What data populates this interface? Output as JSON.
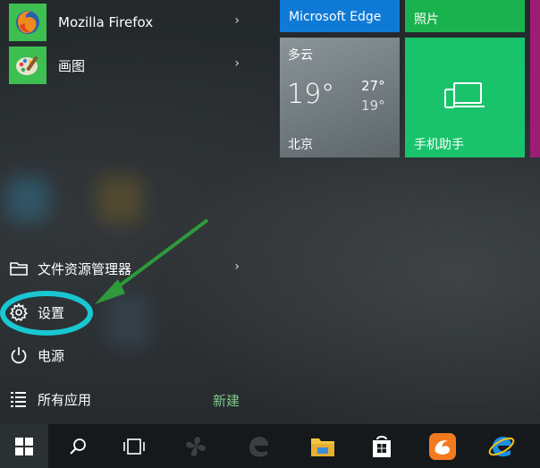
{
  "apps": [
    {
      "label": "Mozilla Firefox",
      "icon": "firefox-icon",
      "color": "#3dbf52"
    },
    {
      "label": "画图",
      "icon": "paint-icon",
      "color": "#3dbf52"
    }
  ],
  "system": {
    "file_explorer": "文件资源管理器",
    "settings": "设置",
    "power": "电源",
    "all_apps": "所有应用",
    "new_badge": "新建"
  },
  "tiles": {
    "edge": {
      "label": "Microsoft Edge",
      "color": "#0f7ad6"
    },
    "photos": {
      "label": "照片",
      "color": "#19b24e"
    },
    "phone": {
      "label": "手机助手",
      "color": "#19c36b"
    },
    "weather": {
      "condition": "多云",
      "temp": "19°",
      "high": "27°",
      "low": "19°",
      "city": "北京"
    }
  },
  "colors": {
    "highlight_ring": "#19c7d1",
    "arrow": "#2e9a3a"
  },
  "taskbar": {
    "items": [
      "windows-start-icon",
      "search-icon",
      "task-view-icon",
      "fan-app-icon",
      "edge-dim-icon",
      "file-explorer-icon",
      "store-icon",
      "uc-browser-icon",
      "internet-explorer-icon"
    ]
  }
}
